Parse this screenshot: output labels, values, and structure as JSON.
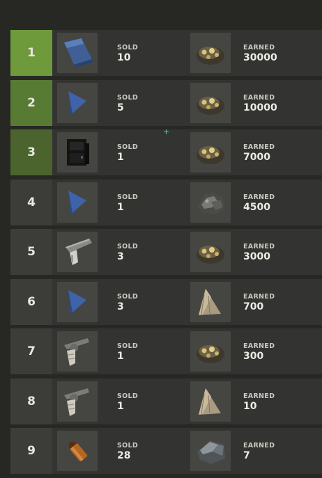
{
  "labels": {
    "sold": "SOLD",
    "earned": "EARNED"
  },
  "colors": {
    "rank_1": "#6f9a3b",
    "rank_2": "#587b33",
    "rank_3": "#4b642e",
    "rank_default": "#3c3c39",
    "row_bg": "#333331",
    "slot_bg": "#454542"
  },
  "rows": [
    {
      "rank": "1",
      "item_icon": "blue-tarp-icon",
      "sold": "10",
      "earned_icon": "gold-ore-icon",
      "earned": "30000"
    },
    {
      "rank": "2",
      "item_icon": "blue-flag-icon",
      "sold": "5",
      "earned_icon": "gold-ore-icon",
      "earned": "10000"
    },
    {
      "rank": "3",
      "item_icon": "black-cabinet-icon",
      "sold": "1",
      "earned_icon": "gold-ore-icon",
      "earned": "7000"
    },
    {
      "rank": "4",
      "item_icon": "blue-flag-icon",
      "sold": "1",
      "earned_icon": "metal-fragments-icon",
      "earned": "4500"
    },
    {
      "rank": "5",
      "item_icon": "pistol-icon",
      "sold": "3",
      "earned_icon": "gold-ore-icon",
      "earned": "3000"
    },
    {
      "rank": "6",
      "item_icon": "blue-flag-icon",
      "sold": "3",
      "earned_icon": "cloth-icon",
      "earned": "700"
    },
    {
      "rank": "7",
      "item_icon": "revolver-icon",
      "sold": "1",
      "earned_icon": "gold-ore-icon",
      "earned": "300"
    },
    {
      "rank": "8",
      "item_icon": "revolver-icon",
      "sold": "1",
      "earned_icon": "cloth-icon",
      "earned": "10"
    },
    {
      "rank": "9",
      "item_icon": "bullet-icon",
      "sold": "28",
      "earned_icon": "stone-icon",
      "earned": "7"
    }
  ]
}
